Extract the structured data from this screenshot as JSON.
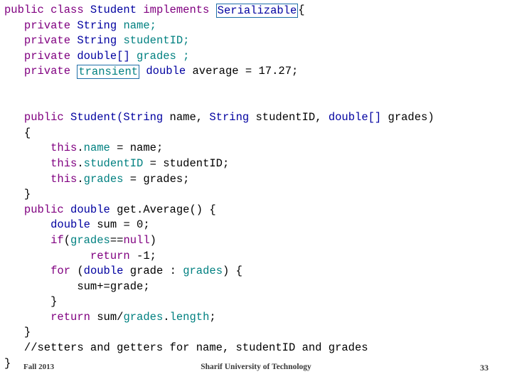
{
  "slide": {
    "code_lines": [
      {
        "id": "l1",
        "segments": [
          {
            "text": "public class ",
            "style": "kw"
          },
          {
            "text": "Student ",
            "style": "blu"
          },
          {
            "text": "implements ",
            "style": "kw"
          },
          {
            "text": "Serializable",
            "style": "blu",
            "boxed": true
          },
          {
            "text": "{",
            "style": "blk"
          }
        ]
      },
      {
        "id": "l2",
        "segments": [
          {
            "text": "   private ",
            "style": "kw"
          },
          {
            "text": "String ",
            "style": "blu"
          },
          {
            "text": "name;",
            "style": "teal"
          }
        ]
      },
      {
        "id": "l3",
        "segments": [
          {
            "text": "   private ",
            "style": "kw"
          },
          {
            "text": "String ",
            "style": "blu"
          },
          {
            "text": "studentID;",
            "style": "teal"
          }
        ]
      },
      {
        "id": "l4",
        "segments": [
          {
            "text": "   private ",
            "style": "kw"
          },
          {
            "text": "double[] ",
            "style": "blu"
          },
          {
            "text": "grades ;",
            "style": "teal"
          }
        ]
      },
      {
        "id": "l5",
        "segments": [
          {
            "text": "   private ",
            "style": "kw"
          },
          {
            "text": "transient",
            "style": "teal",
            "boxed": true
          },
          {
            "text": " double ",
            "style": "blu"
          },
          {
            "text": "average = 17.27;",
            "style": "blk"
          }
        ]
      },
      {
        "id": "l6",
        "segments": []
      },
      {
        "id": "l7",
        "segments": []
      },
      {
        "id": "l8",
        "segments": [
          {
            "text": "   public ",
            "style": "kw"
          },
          {
            "text": "Student(String ",
            "style": "blu"
          },
          {
            "text": "name, ",
            "style": "blk"
          },
          {
            "text": "String ",
            "style": "blu"
          },
          {
            "text": "studentID, ",
            "style": "blk"
          },
          {
            "text": "double[] ",
            "style": "blu"
          },
          {
            "text": "grades)",
            "style": "blk"
          }
        ]
      },
      {
        "id": "l9",
        "segments": [
          {
            "text": "   {",
            "style": "blk"
          }
        ]
      },
      {
        "id": "l10",
        "segments": [
          {
            "text": "       this",
            "style": "kw"
          },
          {
            "text": ".",
            "style": "blk"
          },
          {
            "text": "name ",
            "style": "teal"
          },
          {
            "text": "= name;",
            "style": "blk"
          }
        ]
      },
      {
        "id": "l11",
        "segments": [
          {
            "text": "       this",
            "style": "kw"
          },
          {
            "text": ".",
            "style": "blk"
          },
          {
            "text": "studentID ",
            "style": "teal"
          },
          {
            "text": "= studentID;",
            "style": "blk"
          }
        ]
      },
      {
        "id": "l12",
        "segments": [
          {
            "text": "       this",
            "style": "kw"
          },
          {
            "text": ".",
            "style": "blk"
          },
          {
            "text": "grades ",
            "style": "teal"
          },
          {
            "text": "= grades;",
            "style": "blk"
          }
        ]
      },
      {
        "id": "l13",
        "segments": [
          {
            "text": "   }",
            "style": "blk"
          }
        ]
      },
      {
        "id": "l14",
        "segments": [
          {
            "text": "   public ",
            "style": "kw"
          },
          {
            "text": "double ",
            "style": "blu"
          },
          {
            "text": "get.Average() {",
            "style": "blk"
          }
        ]
      },
      {
        "id": "l15",
        "segments": [
          {
            "text": "       double ",
            "style": "blu"
          },
          {
            "text": "sum = 0;",
            "style": "blk"
          }
        ]
      },
      {
        "id": "l16",
        "segments": [
          {
            "text": "       if",
            "style": "kw"
          },
          {
            "text": "(",
            "style": "blk"
          },
          {
            "text": "grades",
            "style": "teal"
          },
          {
            "text": "==",
            "style": "blk"
          },
          {
            "text": "null",
            "style": "kw"
          },
          {
            "text": ")",
            "style": "blk"
          }
        ]
      },
      {
        "id": "l17",
        "segments": [
          {
            "text": "             return ",
            "style": "kw"
          },
          {
            "text": "-1;",
            "style": "blk"
          }
        ]
      },
      {
        "id": "l18",
        "segments": [
          {
            "text": "       for ",
            "style": "kw"
          },
          {
            "text": "(",
            "style": "blk"
          },
          {
            "text": "double ",
            "style": "blu"
          },
          {
            "text": "grade : ",
            "style": "blk"
          },
          {
            "text": "grades",
            "style": "teal"
          },
          {
            "text": ") {",
            "style": "blk"
          }
        ]
      },
      {
        "id": "l19",
        "segments": [
          {
            "text": "           sum+=grade;",
            "style": "blk"
          }
        ]
      },
      {
        "id": "l20",
        "segments": [
          {
            "text": "       }",
            "style": "blk"
          }
        ]
      },
      {
        "id": "l21",
        "segments": [
          {
            "text": "       return ",
            "style": "kw"
          },
          {
            "text": "sum/",
            "style": "blk"
          },
          {
            "text": "grades",
            "style": "teal"
          },
          {
            "text": ".",
            "style": "blk"
          },
          {
            "text": "length",
            "style": "teal"
          },
          {
            "text": ";",
            "style": "blk"
          }
        ]
      },
      {
        "id": "l22",
        "segments": [
          {
            "text": "   }",
            "style": "blk"
          }
        ]
      },
      {
        "id": "l23",
        "segments": [
          {
            "text": "   //setters and getters for name, studentID and grades",
            "style": "blk"
          }
        ]
      },
      {
        "id": "l24",
        "segments": [
          {
            "text": "}",
            "style": "blk"
          }
        ]
      }
    ],
    "footer": {
      "left": "Fall 2013",
      "center": "Sharif University of Technology",
      "right": "33"
    }
  },
  "colors": {
    "keyword": "#800080",
    "type": "#0000a0",
    "field": "#008080",
    "plain": "#000000",
    "box_border": "#1f6fa8",
    "footer_text": "#3a3a3a",
    "background": "#ffffff"
  }
}
